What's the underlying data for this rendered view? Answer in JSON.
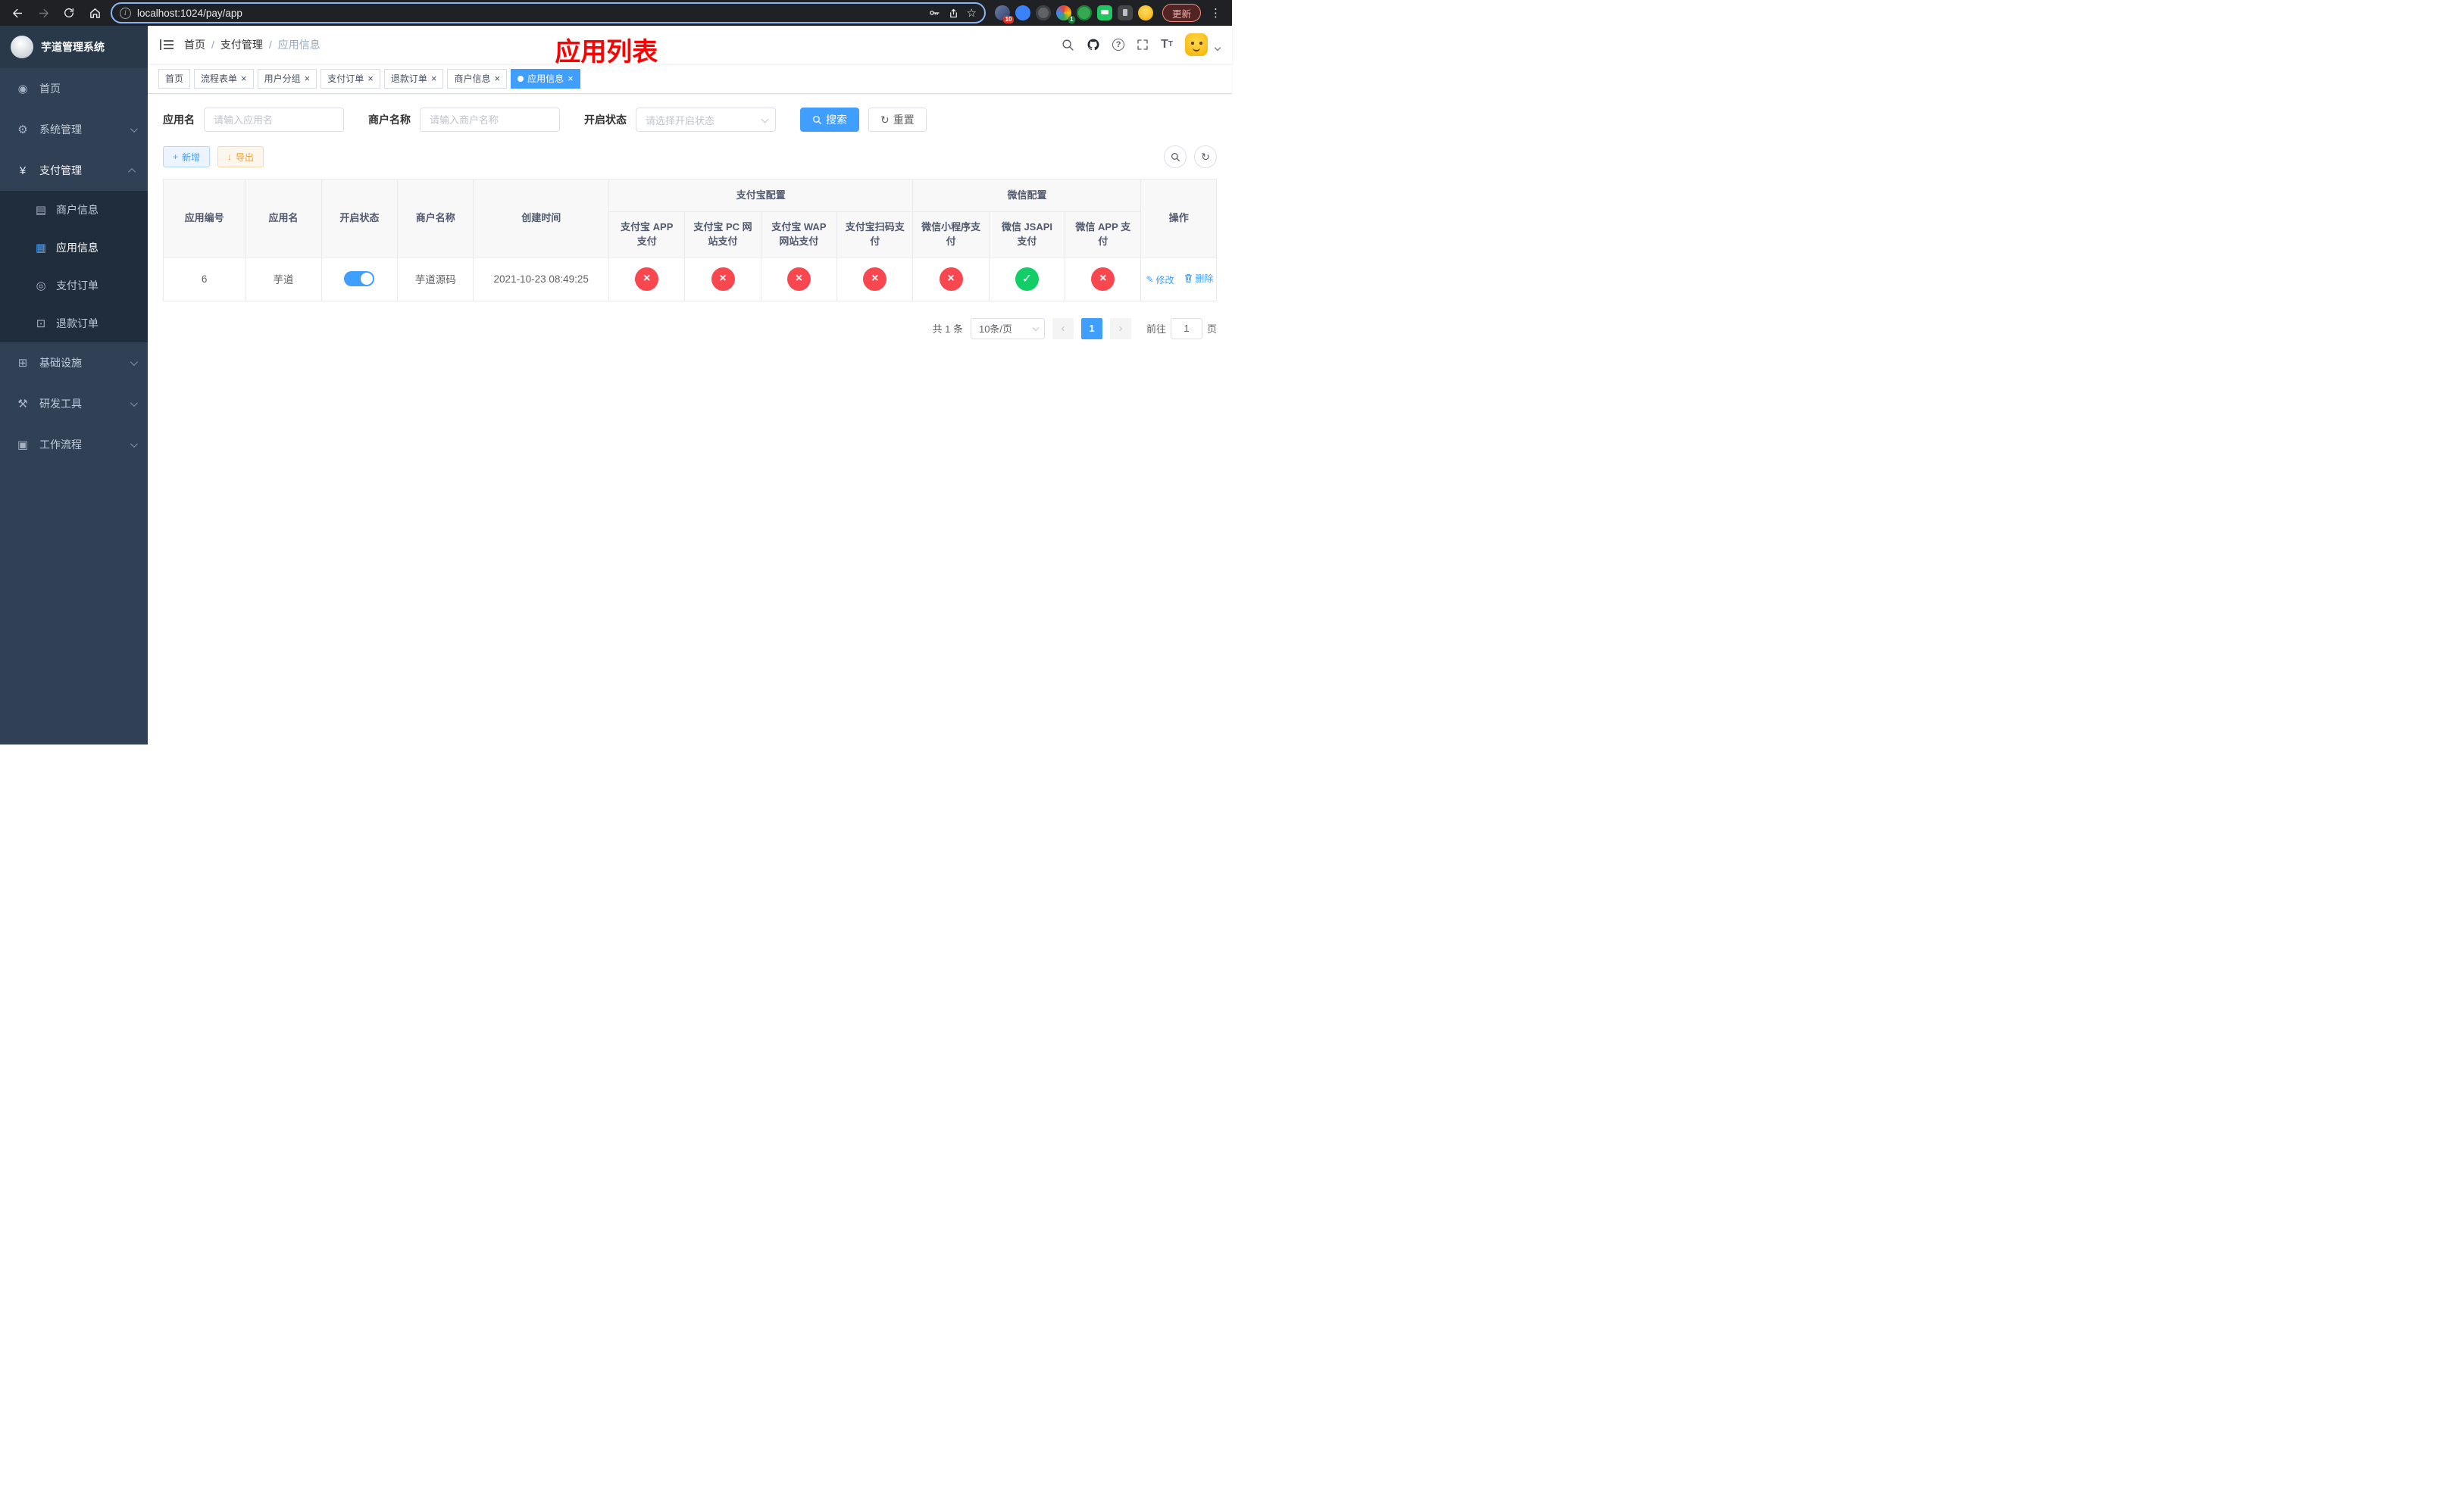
{
  "glyphs": {
    "close": "×",
    "star": "☆",
    "kebab": "⋮",
    "question": "?",
    "info": "i",
    "plus": "+",
    "download": "↓",
    "refresh": "↻",
    "check": "✓",
    "cross": "×",
    "edit": "✎",
    "page_prev": "‹",
    "page_next": "›",
    "font_big": "T",
    "font_small": "T"
  },
  "browser": {
    "url": "localhost:1024/pay/app",
    "update_button": "更新",
    "extension_badge_1": "10",
    "extension_badge_2": "1"
  },
  "sidebar": {
    "logo_title": "芋道管理系统",
    "items": [
      {
        "label": "首页",
        "glyph": "◉"
      },
      {
        "label": "系统管理",
        "glyph": "⚙"
      },
      {
        "label": "支付管理",
        "glyph": "¥"
      },
      {
        "label": "基础设施",
        "glyph": "⊞"
      },
      {
        "label": "研发工具",
        "glyph": "⚒"
      },
      {
        "label": "工作流程",
        "glyph": "▣"
      }
    ],
    "pay_children": [
      {
        "label": "商户信息",
        "glyph": "▤"
      },
      {
        "label": "应用信息",
        "glyph": "▦"
      },
      {
        "label": "支付订单",
        "glyph": "◎"
      },
      {
        "label": "退款订单",
        "glyph": "⊡"
      }
    ]
  },
  "navbar": {
    "breadcrumb": [
      "首页",
      "支付管理",
      "应用信息"
    ],
    "separator": "/",
    "annotation": "应用列表"
  },
  "tabs": [
    {
      "label": "首页"
    },
    {
      "label": "流程表单"
    },
    {
      "label": "用户分组"
    },
    {
      "label": "支付订单"
    },
    {
      "label": "退款订单"
    },
    {
      "label": "商户信息"
    },
    {
      "label": "应用信息"
    }
  ],
  "filters": {
    "app_name_label": "应用名",
    "app_name_placeholder": "请输入应用名",
    "merchant_label": "商户名称",
    "merchant_placeholder": "请输入商户名称",
    "status_label": "开启状态",
    "status_placeholder": "请选择开启状态",
    "search_button": "搜索",
    "reset_button": "重置"
  },
  "toolbar": {
    "add_button": "新增",
    "export_button": "导出"
  },
  "table": {
    "group_alipay": "支付宝配置",
    "group_wechat": "微信配置",
    "columns": [
      "应用编号",
      "应用名",
      "开启状态",
      "商户名称",
      "创建时间",
      "支付宝 APP 支付",
      "支付宝 PC 网站支付",
      "支付宝 WAP 网站支付",
      "支付宝扫码支付",
      "微信小程序支付",
      "微信 JSAPI 支付",
      "微信 APP 支付",
      "操作"
    ],
    "row": {
      "id": "6",
      "app_name": "芋道",
      "enabled": true,
      "merchant": "芋道源码",
      "created_at": "2021-10-23 08:49:25",
      "channels": [
        "fail",
        "fail",
        "fail",
        "fail",
        "fail",
        "success",
        "fail"
      ],
      "edit_label": "修改",
      "delete_label": "删除"
    }
  },
  "pagination": {
    "total": "共 1 条",
    "page_size": "10条/页",
    "page": "1",
    "goto_label": "前往",
    "goto_value": "1",
    "goto_unit": "页"
  }
}
